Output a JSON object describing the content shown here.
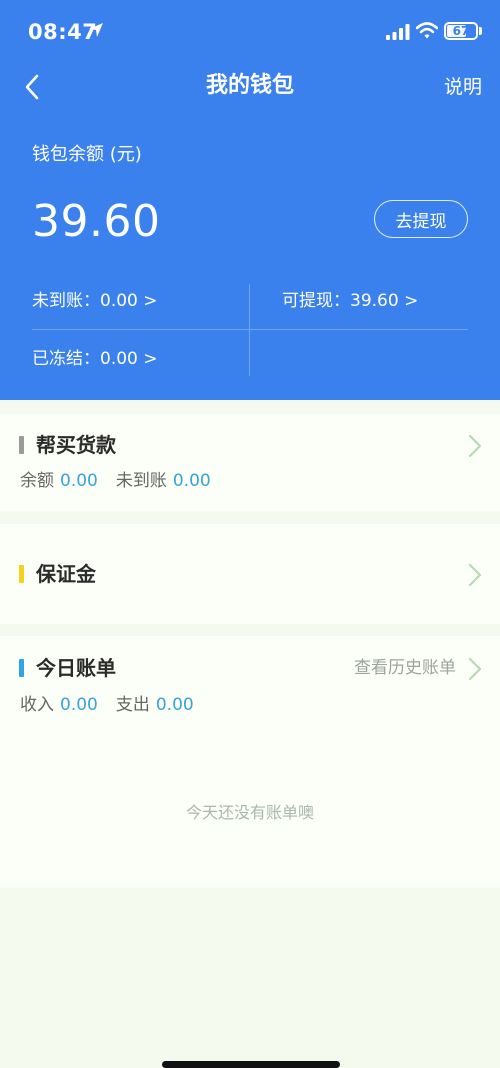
{
  "status_bar": {
    "time": "08:47",
    "battery": "67",
    "battery_level": 0.67
  },
  "nav": {
    "title": "我的钱包",
    "help_label": "说明"
  },
  "wallet": {
    "balance_label": "钱包余额 (元)",
    "balance_amount": "39.60",
    "withdraw_label": "去提现",
    "pending": "未到账：0.00 >",
    "withdrawable": "可提现：39.60 >",
    "frozen": "已冻结：0.00 >"
  },
  "buy_payment": {
    "title": "帮买货款",
    "balance_label": "余额",
    "balance_value": "0.00",
    "pending_label": "未到账",
    "pending_value": "0.00",
    "bar_color": "#9a9a9a"
  },
  "deposit": {
    "title": "保证金",
    "bar_color": "#f5d21d"
  },
  "today_bill": {
    "title": "今日账单",
    "history_label": "查看历史账单",
    "income_label": "收入",
    "income_value": "0.00",
    "expense_label": "支出",
    "expense_value": "0.00",
    "empty_message": "今天还没有账单噢",
    "bar_color": "#2fa6e0"
  },
  "colors": {
    "header_bg": "#3a81ee",
    "accent_value": "#3aa3d6",
    "chevron": "#b9d9b2"
  }
}
